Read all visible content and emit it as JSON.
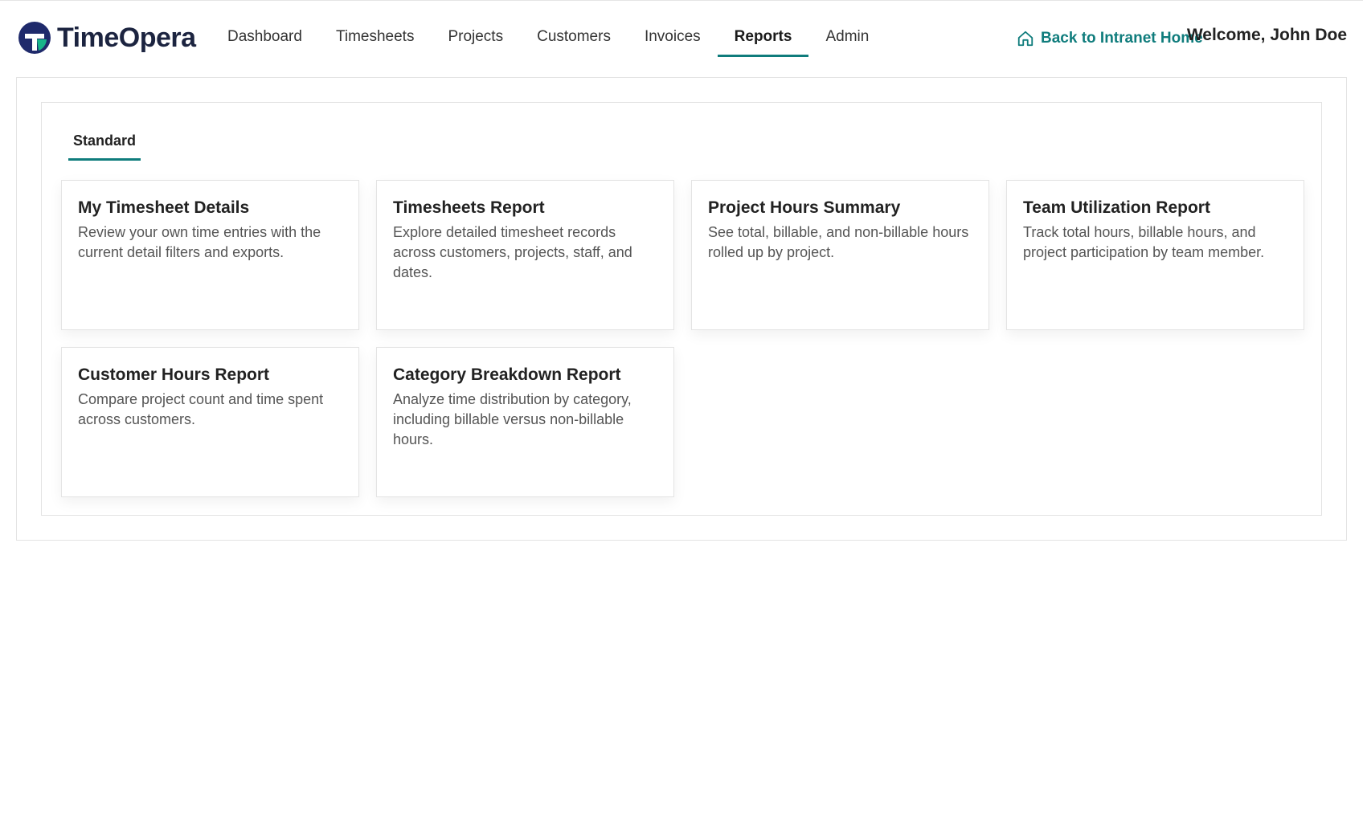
{
  "brand": {
    "name": "TimeOpera",
    "colors": {
      "mark_dark": "#1f2a6b",
      "mark_green": "#17b58a",
      "accent": "#0f7c7c"
    }
  },
  "nav": {
    "items": [
      {
        "label": "Dashboard",
        "active": false
      },
      {
        "label": "Timesheets",
        "active": false
      },
      {
        "label": "Projects",
        "active": false
      },
      {
        "label": "Customers",
        "active": false
      },
      {
        "label": "Invoices",
        "active": false
      },
      {
        "label": "Reports",
        "active": true
      },
      {
        "label": "Admin",
        "active": false
      }
    ]
  },
  "header": {
    "back_link_label": "Back to Intranet Home",
    "back_link_icon": "home-icon",
    "welcome": "Welcome, John Doe"
  },
  "tabs": [
    {
      "label": "Standard",
      "active": true
    }
  ],
  "reports": [
    {
      "title": "My Timesheet Details",
      "description": "Review your own time entries with the current detail filters and exports."
    },
    {
      "title": "Timesheets Report",
      "description": "Explore detailed timesheet records across customers, projects, staff, and dates."
    },
    {
      "title": "Project Hours Summary",
      "description": "See total, billable, and non-billable hours rolled up by project."
    },
    {
      "title": "Team Utilization Report",
      "description": "Track total hours, billable hours, and project participation by team member."
    },
    {
      "title": "Customer Hours Report",
      "description": "Compare project count and time spent across customers."
    },
    {
      "title": "Category Breakdown Report",
      "description": "Analyze time distribution by category, including billable versus non-billable hours."
    }
  ]
}
